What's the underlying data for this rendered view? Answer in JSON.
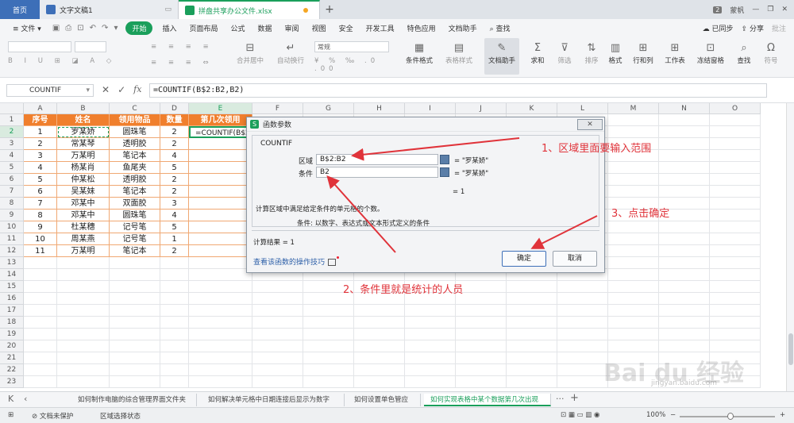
{
  "titlebar": {
    "home": "首页",
    "tab1": "文字文稿1",
    "tab2": "拼盘共享办公文件.xlsx",
    "count": "2",
    "user": "蒙帆"
  },
  "menu": {
    "file": "文件",
    "start": "开始",
    "items": [
      "插入",
      "页面布局",
      "公式",
      "数据",
      "审阅",
      "视图",
      "安全",
      "开发工具",
      "特色应用",
      "文档助手"
    ],
    "search": "查找",
    "sync": "已同步",
    "share": "分享",
    "comment": "批注"
  },
  "ribbon": {
    "format_value": "常规",
    "merge": "合并居中",
    "wrap": "自动换行",
    "cond_format": "条件格式",
    "table_style": "表格样式",
    "doc_helper": "文档助手",
    "sum": "求和",
    "filter": "筛选",
    "sort": "排序",
    "format": "格式",
    "row_col": "行和列",
    "worksheet": "工作表",
    "freeze": "冻结窗格",
    "find": "查找",
    "symbol": "符号"
  },
  "formula_bar": {
    "name_box": "COUNTIF",
    "formula": "=COUNTIF(B$2:B2,B2)"
  },
  "sheet": {
    "columns": [
      "A",
      "B",
      "C",
      "D",
      "E",
      "F",
      "G",
      "H",
      "I",
      "J",
      "K",
      "L",
      "M",
      "N",
      "O"
    ],
    "header": [
      "序号",
      "姓名",
      "领用物品",
      "数量",
      "第几次领用"
    ],
    "rows": [
      [
        "1",
        "罗某娇",
        "圆珠笔",
        "2"
      ],
      [
        "2",
        "常某琴",
        "透明胶",
        "2"
      ],
      [
        "3",
        "万某明",
        "笔记本",
        "4"
      ],
      [
        "4",
        "杨某肖",
        "鱼尾夹",
        "5"
      ],
      [
        "5",
        "仲某松",
        "透明胶",
        "2"
      ],
      [
        "6",
        "吴某妹",
        "笔记本",
        "2"
      ],
      [
        "7",
        "邓某中",
        "双面胶",
        "3"
      ],
      [
        "8",
        "邓某中",
        "圆珠笔",
        "4"
      ],
      [
        "9",
        "杜某穗",
        "记号笔",
        "5"
      ],
      [
        "10",
        "周某燕",
        "记号笔",
        "1"
      ],
      [
        "11",
        "万某明",
        "笔记本",
        "2"
      ]
    ],
    "active_cell_text": "=COUNTIF(B$2: B",
    "row_numbers": [
      "1",
      "2",
      "3",
      "4",
      "5",
      "6",
      "7",
      "8",
      "9",
      "10",
      "11",
      "12",
      "13",
      "14",
      "15",
      "16",
      "17",
      "18",
      "19",
      "20",
      "21",
      "22",
      "23"
    ]
  },
  "dialog": {
    "title": "函数参数",
    "func": "COUNTIF",
    "arg1_label": "区域",
    "arg1_value": "B$2:B2",
    "arg1_result": "= \"罗某娇\"",
    "arg2_label": "条件",
    "arg2_value": "B2",
    "arg2_result": "= \"罗某娇\"",
    "total": "= 1",
    "description": "计算区域中满足给定条件的单元格的个数。",
    "param_desc": "条件:  以数字、表达式或文本形式定义的条件",
    "result": "计算结果 = 1",
    "help_link": "查看该函数的操作技巧",
    "ok": "确定",
    "cancel": "取消"
  },
  "annotations": {
    "a1": "1、区域里面要输入范围",
    "a2": "2、条件里就是统计的人员",
    "a3": "3、点击确定"
  },
  "sheet_tabs": [
    "如何制作电脑的综合管理界面文件夹",
    "如何解决单元格中日期连接后显示为数字",
    "如何设置单色管应",
    "如何实现表格中某个数据第几次出现"
  ],
  "status": {
    "protect": "文档未保护",
    "select": "区域选择状态",
    "zoom": "100%"
  },
  "watermark": {
    "main": "Bai du 经验",
    "sub": "jingyan.baidu.com"
  },
  "colors": {
    "header_orange": "#f07f2d",
    "accent_green": "#1a9f5b",
    "annotation_red": "#e0333a"
  }
}
